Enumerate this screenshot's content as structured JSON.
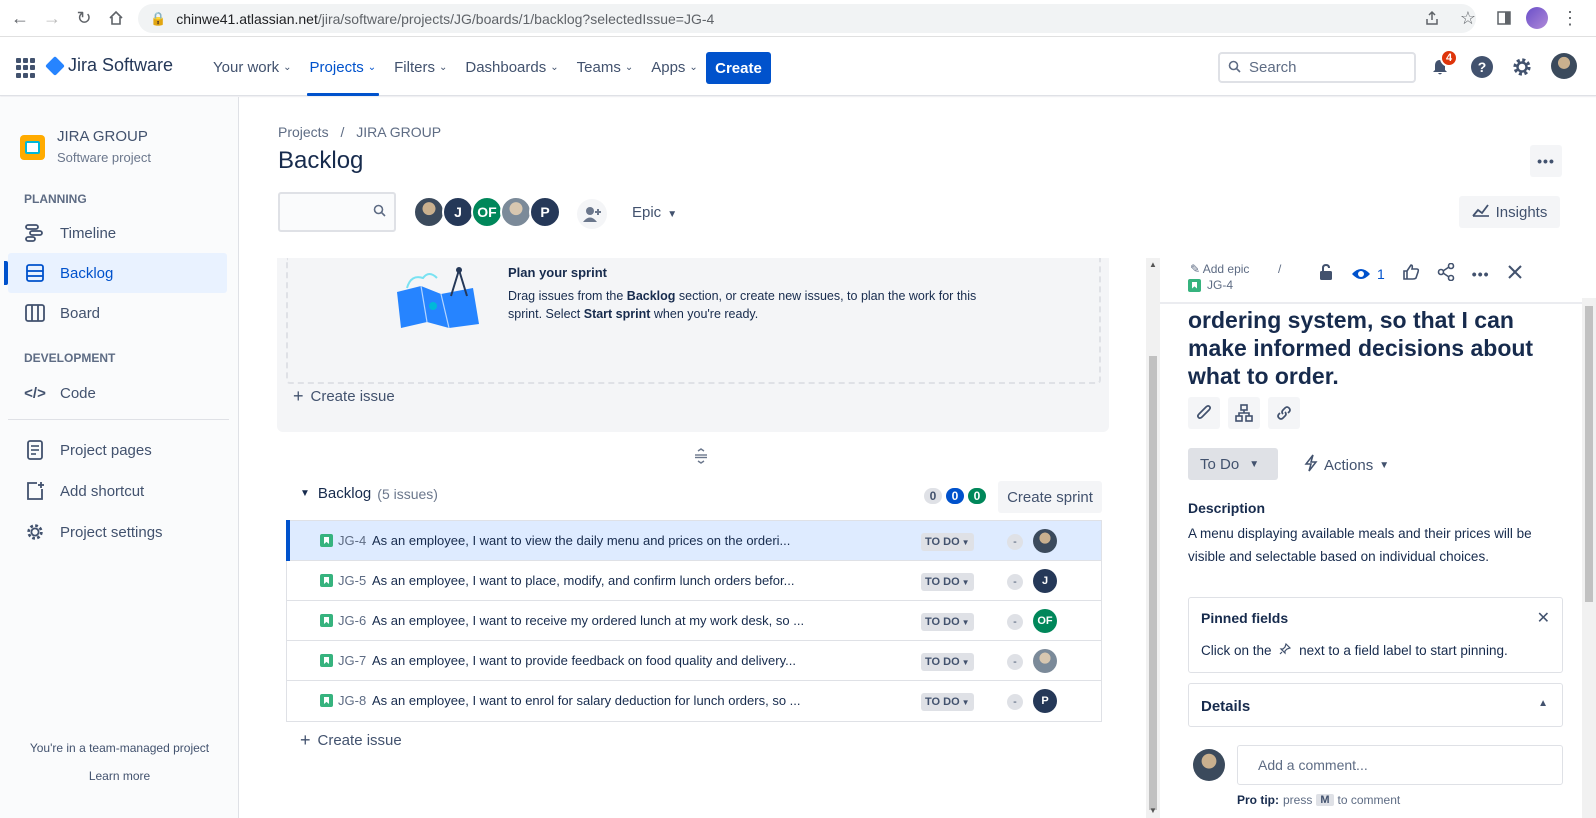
{
  "browser": {
    "url_host": "chinwe41.atlassian.net",
    "url_path": "/jira/software/projects/JG/boards/1/backlog?selectedIssue=JG-4"
  },
  "topnav": {
    "product": "Jira Software",
    "items": [
      {
        "label": "Your work",
        "active": false
      },
      {
        "label": "Projects",
        "active": true
      },
      {
        "label": "Filters",
        "active": false
      },
      {
        "label": "Dashboards",
        "active": false
      },
      {
        "label": "Teams",
        "active": false
      },
      {
        "label": "Apps",
        "active": false
      }
    ],
    "create_label": "Create",
    "search_placeholder": "Search",
    "notifications_count": "4"
  },
  "sidebar": {
    "project_name": "JIRA GROUP",
    "project_type": "Software project",
    "planning_label": "PLANNING",
    "planning_items": [
      {
        "label": "Timeline",
        "icon": "timeline-icon"
      },
      {
        "label": "Backlog",
        "icon": "backlog-icon",
        "active": true
      },
      {
        "label": "Board",
        "icon": "board-icon"
      }
    ],
    "development_label": "DEVELOPMENT",
    "code_label": "Code",
    "extra_items": [
      {
        "label": "Project pages",
        "icon": "pages-icon"
      },
      {
        "label": "Add shortcut",
        "icon": "add-shortcut-icon"
      },
      {
        "label": "Project settings",
        "icon": "gear-icon"
      }
    ],
    "footer_text": "You're in a team-managed project",
    "learn_more": "Learn more"
  },
  "main": {
    "breadcrumb_projects": "Projects",
    "breadcrumb_sep": "/",
    "breadcrumb_project": "JIRA GROUP",
    "title": "Backlog",
    "avatars": [
      {
        "initials": "",
        "style": "photo"
      },
      {
        "initials": "J",
        "style": "navy"
      },
      {
        "initials": "OF",
        "style": "green"
      },
      {
        "initials": "",
        "style": "photo2"
      },
      {
        "initials": "P",
        "style": "navy"
      }
    ],
    "epic_label": "Epic",
    "insights_label": "Insights"
  },
  "sprint": {
    "plan_title": "Plan your sprint",
    "plan_text_1": "Drag issues from the ",
    "plan_text_bold1": "Backlog",
    "plan_text_2": " section, or create new issues, to plan the work for this sprint. Select ",
    "plan_text_bold2": "Start sprint",
    "plan_text_3": " when you're ready.",
    "create_issue": "Create issue"
  },
  "backlog": {
    "label": "Backlog",
    "count": "(5 issues)",
    "pill_todo": "0",
    "pill_inprogress": "0",
    "pill_done": "0",
    "create_sprint": "Create sprint",
    "create_issue": "Create issue",
    "issues": [
      {
        "key": "JG-4",
        "summary": "As an employee, I want to view the daily menu and prices on the orderi...",
        "status": "TO DO",
        "estimate": "-",
        "assignee": "",
        "assignee_style": "photo"
      },
      {
        "key": "JG-5",
        "summary": "As an employee, I want to place, modify, and confirm lunch orders befor...",
        "status": "TO DO",
        "estimate": "-",
        "assignee": "J",
        "assignee_style": "navy"
      },
      {
        "key": "JG-6",
        "summary": "As an employee, I want to receive my ordered lunch at my work desk, so ...",
        "status": "TO DO",
        "estimate": "-",
        "assignee": "OF",
        "assignee_style": "green"
      },
      {
        "key": "JG-7",
        "summary": "As an employee, I want to provide feedback on food quality and delivery...",
        "status": "TO DO",
        "estimate": "-",
        "assignee": "",
        "assignee_style": "photo2"
      },
      {
        "key": "JG-8",
        "summary": "As an employee, I want to enrol for salary deduction for lunch orders, so ...",
        "status": "TO DO",
        "estimate": "-",
        "assignee": "P",
        "assignee_style": "navy"
      }
    ]
  },
  "detail": {
    "add_epic": "Add epic",
    "crumb_sep": "/",
    "key": "JG-4",
    "watch_count": "1",
    "title": "ordering system, so that I can make informed decisions about what to order.",
    "status_label": "To Do",
    "actions_label": "Actions",
    "description_label": "Description",
    "description": "A menu displaying available meals and their prices will be visible and selectable based on individual choices.",
    "pinned_title": "Pinned fields",
    "pinned_hint_1": "Click on the",
    "pinned_hint_2": "next to a field label to start pinning.",
    "details_title": "Details",
    "comment_placeholder": "Add a comment...",
    "pro_tip_bold": "Pro tip:",
    "pro_tip_1": "press",
    "pro_tip_key": "M",
    "pro_tip_2": "to comment"
  },
  "colors": {
    "accent": "#0052CC",
    "success": "#00875A",
    "danger": "#DE350B",
    "story": "#36B37E"
  }
}
